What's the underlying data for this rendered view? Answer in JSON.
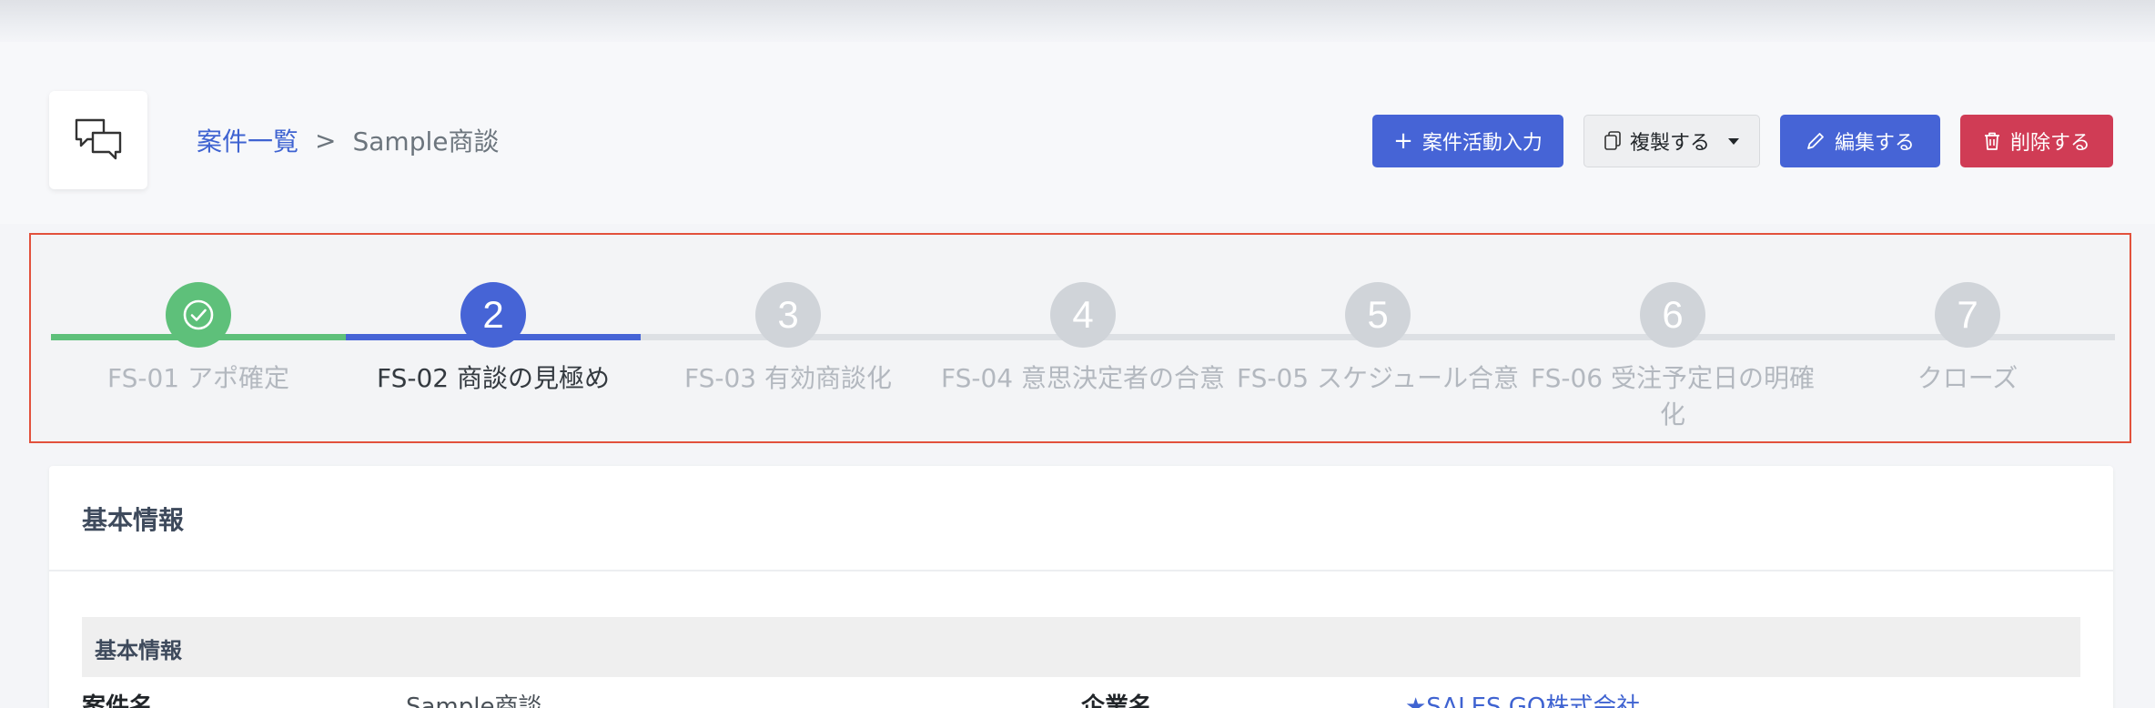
{
  "breadcrumb": {
    "parent": "案件一覧",
    "separator": ">",
    "current": "Sample商談"
  },
  "actions": {
    "activity_label": "案件活動入力",
    "duplicate_label": "複製する",
    "edit_label": "編集する",
    "delete_label": "削除する"
  },
  "stepper": {
    "current_step": 2,
    "steps": [
      {
        "label": "FS-01 アポ確定",
        "marker": "",
        "status": "completed"
      },
      {
        "label": "FS-02 商談の見極め",
        "marker": "2",
        "status": "current"
      },
      {
        "label": "FS-03 有効商談化",
        "marker": "3",
        "status": "pending"
      },
      {
        "label": "FS-04 意思決定者の合意",
        "marker": "4",
        "status": "pending"
      },
      {
        "label": "FS-05 スケジュール合意",
        "marker": "5",
        "status": "pending"
      },
      {
        "label": "FS-06 受注予定日の明確化",
        "marker": "6",
        "status": "pending"
      },
      {
        "label": "クローズ",
        "marker": "7",
        "status": "pending"
      }
    ]
  },
  "basic_info": {
    "card_title": "基本情報",
    "section_title": "基本情報",
    "fields": [
      {
        "label": "案件名",
        "value": "Sample商談"
      },
      {
        "label": "企業名",
        "value": "★SALES GO株式会社"
      }
    ]
  },
  "colors": {
    "primary": "#4664d6",
    "danger": "#d03c55",
    "completed": "#5ec07a",
    "pending": "#d0d4d9",
    "highlight_border": "#e2513c"
  }
}
